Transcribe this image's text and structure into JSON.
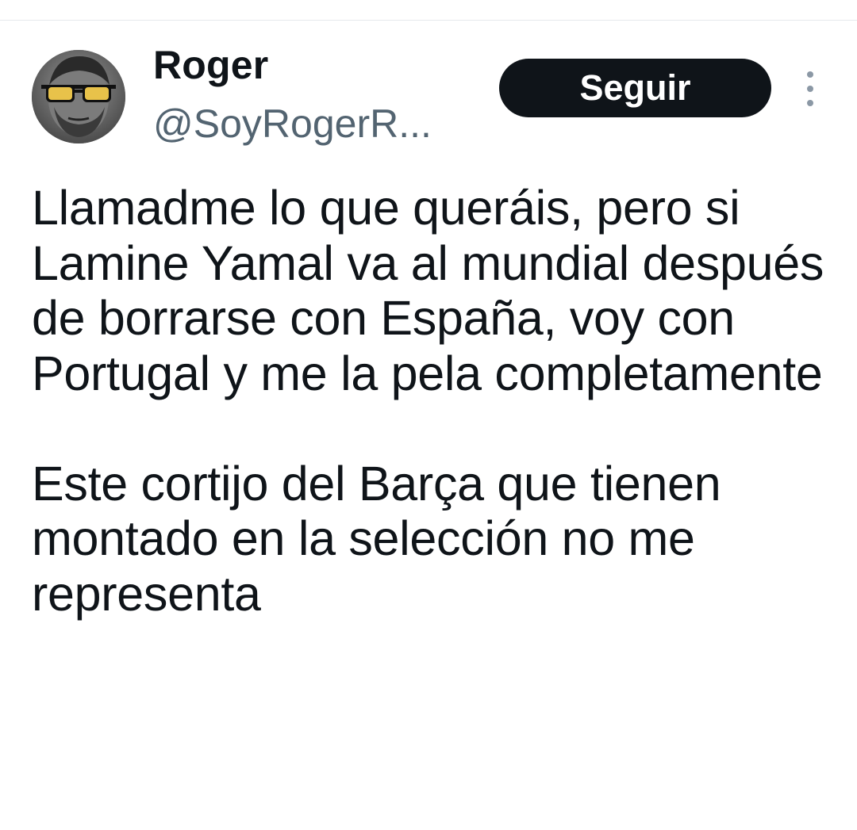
{
  "author": {
    "display_name": "Roger",
    "handle": "@SoyRogerR...",
    "avatar_icon": "profile-photo-man-yellow-sunglasses"
  },
  "actions": {
    "follow_label": "Seguir",
    "more_icon": "more-vertical-icon"
  },
  "tweet": {
    "paragraphs": [
      "Llamadme lo que queráis, pero si Lamine Yamal va al mundial después de borrarse con España, voy con Portugal y me la pela completamente",
      "Este cortijo del Barça que tienen montado en la selección no me representa"
    ]
  },
  "colors": {
    "text_primary": "#0f1419",
    "text_secondary": "#536471",
    "button_bg": "#0f1419",
    "button_text": "#ffffff",
    "divider": "#e6e9ec"
  }
}
